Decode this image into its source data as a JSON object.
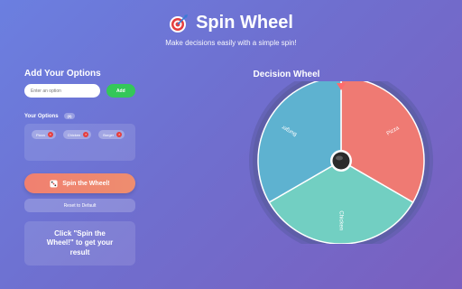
{
  "header": {
    "title": "Spin Wheel",
    "subtitle": "Make decisions easily with a simple spin!",
    "icon": "target-dart-icon"
  },
  "left": {
    "add_heading": "Add Your Options",
    "input": {
      "placeholder": "Enter an option",
      "value": ""
    },
    "add_button": "Add",
    "options_heading": "Your Options",
    "options_count": "(3)",
    "options": [
      {
        "label": "Pizza"
      },
      {
        "label": "Chicken"
      },
      {
        "label": "Burger"
      }
    ],
    "remove_glyph": "×",
    "spin_button": "Spin the Wheel!",
    "spin_icon": "dice-icon",
    "reset_button": "Reset to Default",
    "result_text": "Click \"Spin the Wheel!\" to get your result"
  },
  "wheel": {
    "title": "Decision Wheel",
    "segments": [
      {
        "label": "Pizza",
        "color": "#ef7a73"
      },
      {
        "label": "Chicken",
        "color": "#72cfc2"
      },
      {
        "label": "Burger",
        "color": "#5eb2d0"
      }
    ],
    "pointer_color": "#ff6b6b",
    "rim_color": "#5e5ea8",
    "hub_color": "#2b2b2b"
  },
  "colors": {
    "accent": "#34c759",
    "spin_button": "#f08070",
    "remove_badge": "#e53e3e"
  }
}
